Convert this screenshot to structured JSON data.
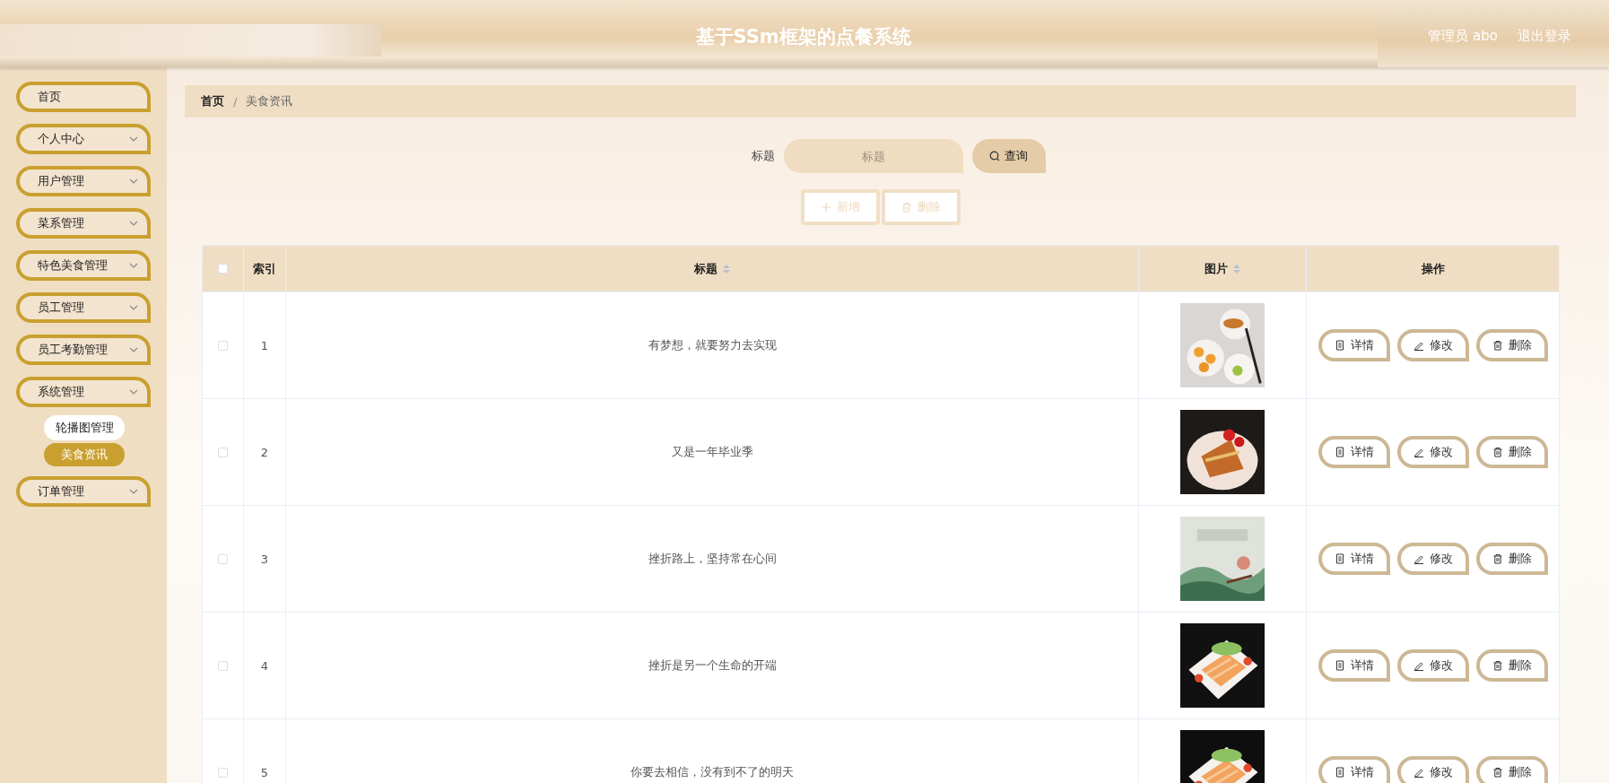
{
  "header": {
    "title": "基于SSm框架的点餐系统",
    "user": "管理员 abo",
    "logout": "退出登录"
  },
  "sidebar": {
    "items": [
      {
        "label": "首页",
        "expandable": false
      },
      {
        "label": "个人中心",
        "expandable": true
      },
      {
        "label": "用户管理",
        "expandable": true
      },
      {
        "label": "菜系管理",
        "expandable": true
      },
      {
        "label": "特色美食管理",
        "expandable": true
      },
      {
        "label": "员工管理",
        "expandable": true
      },
      {
        "label": "员工考勤管理",
        "expandable": true
      },
      {
        "label": "系统管理",
        "expandable": true,
        "children": [
          {
            "label": "轮播图管理",
            "selected": false
          },
          {
            "label": "美食资讯",
            "selected": true
          }
        ]
      },
      {
        "label": "订单管理",
        "expandable": true
      }
    ]
  },
  "breadcrumb": {
    "separator": "/",
    "items": [
      {
        "label": "首页",
        "current": false
      },
      {
        "label": "美食资讯",
        "current": true
      }
    ]
  },
  "search": {
    "label": "标题",
    "placeholder": "标题",
    "button": "查询"
  },
  "toolbar": [
    {
      "kind": "add",
      "label": "新增",
      "disabled": true
    },
    {
      "kind": "delete",
      "label": "删除",
      "disabled": true
    }
  ],
  "table": {
    "all_checked": false,
    "columns": [
      {
        "label": "索引",
        "sortable": false
      },
      {
        "label": "标题",
        "sortable": true
      },
      {
        "label": "图片",
        "sortable": true
      },
      {
        "label": "操作",
        "sortable": false
      }
    ],
    "rows": [
      {
        "checked": false,
        "index": "1",
        "title": "有梦想，就要努力去实现",
        "picture": {
          "kind": "picture"
        },
        "actions": [
          {
            "kind": "detail",
            "label": "详情"
          },
          {
            "kind": "edit",
            "label": "修改"
          },
          {
            "kind": "delete",
            "label": "删除"
          }
        ]
      },
      {
        "checked": false,
        "index": "2",
        "title": "又是一年毕业季",
        "picture": {
          "kind": "picture"
        },
        "actions": [
          {
            "kind": "detail",
            "label": "详情"
          },
          {
            "kind": "edit",
            "label": "修改"
          },
          {
            "kind": "delete",
            "label": "删除"
          }
        ]
      },
      {
        "checked": false,
        "index": "3",
        "title": "挫折路上，坚持常在心间",
        "picture": {
          "kind": "picture"
        },
        "actions": [
          {
            "kind": "detail",
            "label": "详情"
          },
          {
            "kind": "edit",
            "label": "修改"
          },
          {
            "kind": "delete",
            "label": "删除"
          }
        ]
      },
      {
        "checked": false,
        "index": "4",
        "title": "挫折是另一个生命的开端",
        "picture": {
          "kind": "picture"
        },
        "actions": [
          {
            "kind": "detail",
            "label": "详情"
          },
          {
            "kind": "edit",
            "label": "修改"
          },
          {
            "kind": "delete",
            "label": "删除"
          }
        ]
      },
      {
        "checked": false,
        "index": "5",
        "title": "你要去相信，没有到不了的明天",
        "picture": {
          "kind": "picture"
        },
        "actions": [
          {
            "kind": "detail",
            "label": "详情"
          },
          {
            "kind": "edit",
            "label": "修改"
          },
          {
            "kind": "delete",
            "label": "删除"
          }
        ]
      }
    ]
  }
}
